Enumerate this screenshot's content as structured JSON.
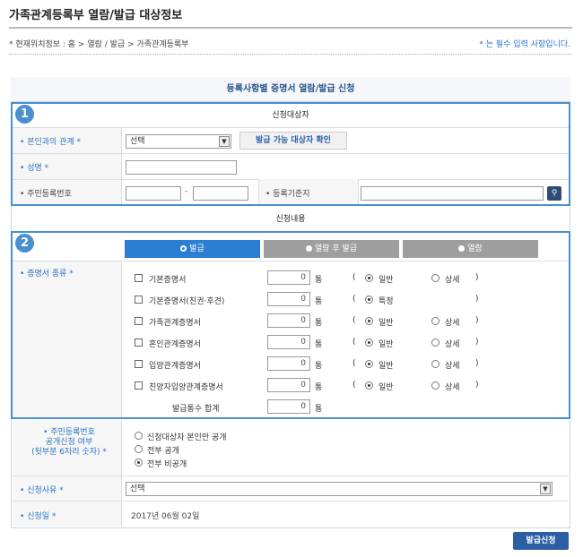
{
  "page": {
    "title": "가족관계등록부 열람/발급 대상정보",
    "breadcrumb": "* 현재위치정보 : 홈 > 열람 / 발급 > 가족관계등록부",
    "required_note": "* 는 필수 입력 사항입니다."
  },
  "form": {
    "header": "등록사항별 증명서 열람/발급 신청",
    "section1": {
      "number": "1",
      "title": "신청대상자",
      "relation_label": "본인과의 관계 *",
      "relation_value": "선택",
      "check_button": "발급 가능 대상자 확인",
      "name_label": "성명 *",
      "rrn_label": "주민등록번호",
      "rrn_sep": "-",
      "regbase_label": "등록기준지",
      "search_icon": "search-icon"
    },
    "section2": {
      "number": "2",
      "title": "신청내용",
      "tabs": [
        "발급",
        "열람 후 발급",
        "열람"
      ],
      "cert_label": "증명서 종류 *",
      "certs": [
        {
          "name": "기본증명서",
          "qty": "0",
          "unit": "통",
          "lp": "(",
          "r1": "일반",
          "r2": "상세",
          "rp": ")"
        },
        {
          "name": "기본증명서(친권·후견)",
          "qty": "0",
          "unit": "통",
          "lp": "(",
          "r1": "특정",
          "r2": "",
          "rp": ")"
        },
        {
          "name": "가족관계증명서",
          "qty": "0",
          "unit": "통",
          "lp": "(",
          "r1": "일반",
          "r2": "상세",
          "rp": ")"
        },
        {
          "name": "혼인관계증명서",
          "qty": "0",
          "unit": "통",
          "lp": "(",
          "r1": "일반",
          "r2": "상세",
          "rp": ")"
        },
        {
          "name": "입양관계증명서",
          "qty": "0",
          "unit": "통",
          "lp": "(",
          "r1": "일반",
          "r2": "상세",
          "rp": ")"
        },
        {
          "name": "친양자입양관계증명서",
          "qty": "0",
          "unit": "통",
          "lp": "(",
          "r1": "일반",
          "r2": "상세",
          "rp": ")"
        }
      ],
      "total_label": "발급통수 합계",
      "total_qty": "0",
      "total_unit": "통"
    },
    "disclosure": {
      "label_line1": "주민등록번호",
      "label_line2": "공개신청 여부",
      "label_line3": "(뒷부분 6자리 숫자) *",
      "options": [
        "신청대상자 본인만 공개",
        "전부 공개",
        "전부 비공개"
      ]
    },
    "reason": {
      "label": "신청사유 *",
      "value": "선택"
    },
    "date": {
      "label": "신청일 *",
      "value": "2017년 06월 02일"
    },
    "submit": "발급신청"
  },
  "colors": {
    "accent": "#4a90d0",
    "tab_active": "#2c7ed2",
    "tab_inactive": "#9e9e9e",
    "submit": "#2c5ea3"
  }
}
